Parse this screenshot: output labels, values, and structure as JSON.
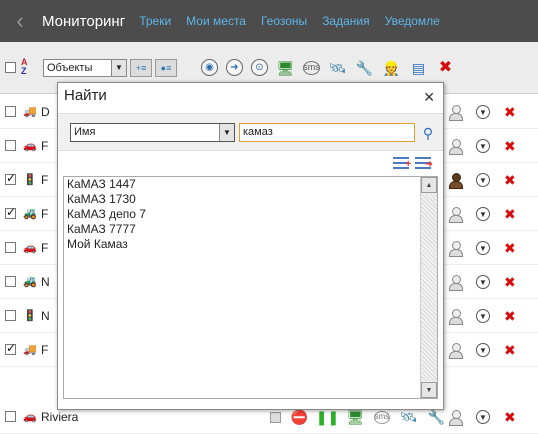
{
  "nav": {
    "back_icon": "chevron-left",
    "title": "Мониторинг",
    "links": [
      "Треки",
      "Мои места",
      "Геозоны",
      "Задания",
      "Уведомле"
    ]
  },
  "toolbar": {
    "sort_icon": "sort-az",
    "filter_select": "Объекты",
    "icon_names": [
      "locator-icon",
      "route-icon",
      "geofence-icon",
      "computer-icon",
      "sms-icon",
      "satellite-icon",
      "wrench-icon",
      "driver-icon",
      "report-icon",
      "delete-icon"
    ]
  },
  "rows": [
    {
      "checked": false,
      "vehicle_icon": "blue-truck",
      "vehicle_color": "#3a6fb0",
      "name": "D"
    },
    {
      "checked": false,
      "vehicle_icon": "red-car",
      "vehicle_color": "#c8242a",
      "name": "F"
    },
    {
      "checked": true,
      "vehicle_icon": "traffic-light",
      "vehicle_color": "#2a9a2a",
      "name": "F",
      "driver": "dark"
    },
    {
      "checked": true,
      "vehicle_icon": "tractor",
      "vehicle_color": "#7a6a2a",
      "name": "F"
    },
    {
      "checked": false,
      "vehicle_icon": "car",
      "vehicle_color": "#3a4a6a",
      "name": "F"
    },
    {
      "checked": false,
      "vehicle_icon": "bulldozer",
      "vehicle_color": "#b0901a",
      "name": "N"
    },
    {
      "checked": false,
      "vehicle_icon": "traffic-light",
      "vehicle_color": "#2a9a2a",
      "name": "N"
    },
    {
      "checked": true,
      "vehicle_icon": "yellow-truck",
      "vehicle_color": "#d0a020",
      "name": "F"
    }
  ],
  "last_row": {
    "checked": false,
    "vehicle_icon": "red-car",
    "name": "Riviera"
  },
  "dialog": {
    "title": "Найти",
    "close_icon": "close",
    "field_select": "Имя",
    "search_value": "камаз",
    "search_icon": "person-search",
    "results": [
      "КаМАЗ 1447",
      "КаМАЗ 1730",
      "КаМАЗ депо 7",
      "КаМАЗ 7777",
      "Мой Камаз"
    ]
  },
  "colors": {
    "nav_bg": "#4c4c4c",
    "nav_link": "#5fb6e8",
    "delete_red": "#d60b0b",
    "input_border": "#e0a030"
  }
}
